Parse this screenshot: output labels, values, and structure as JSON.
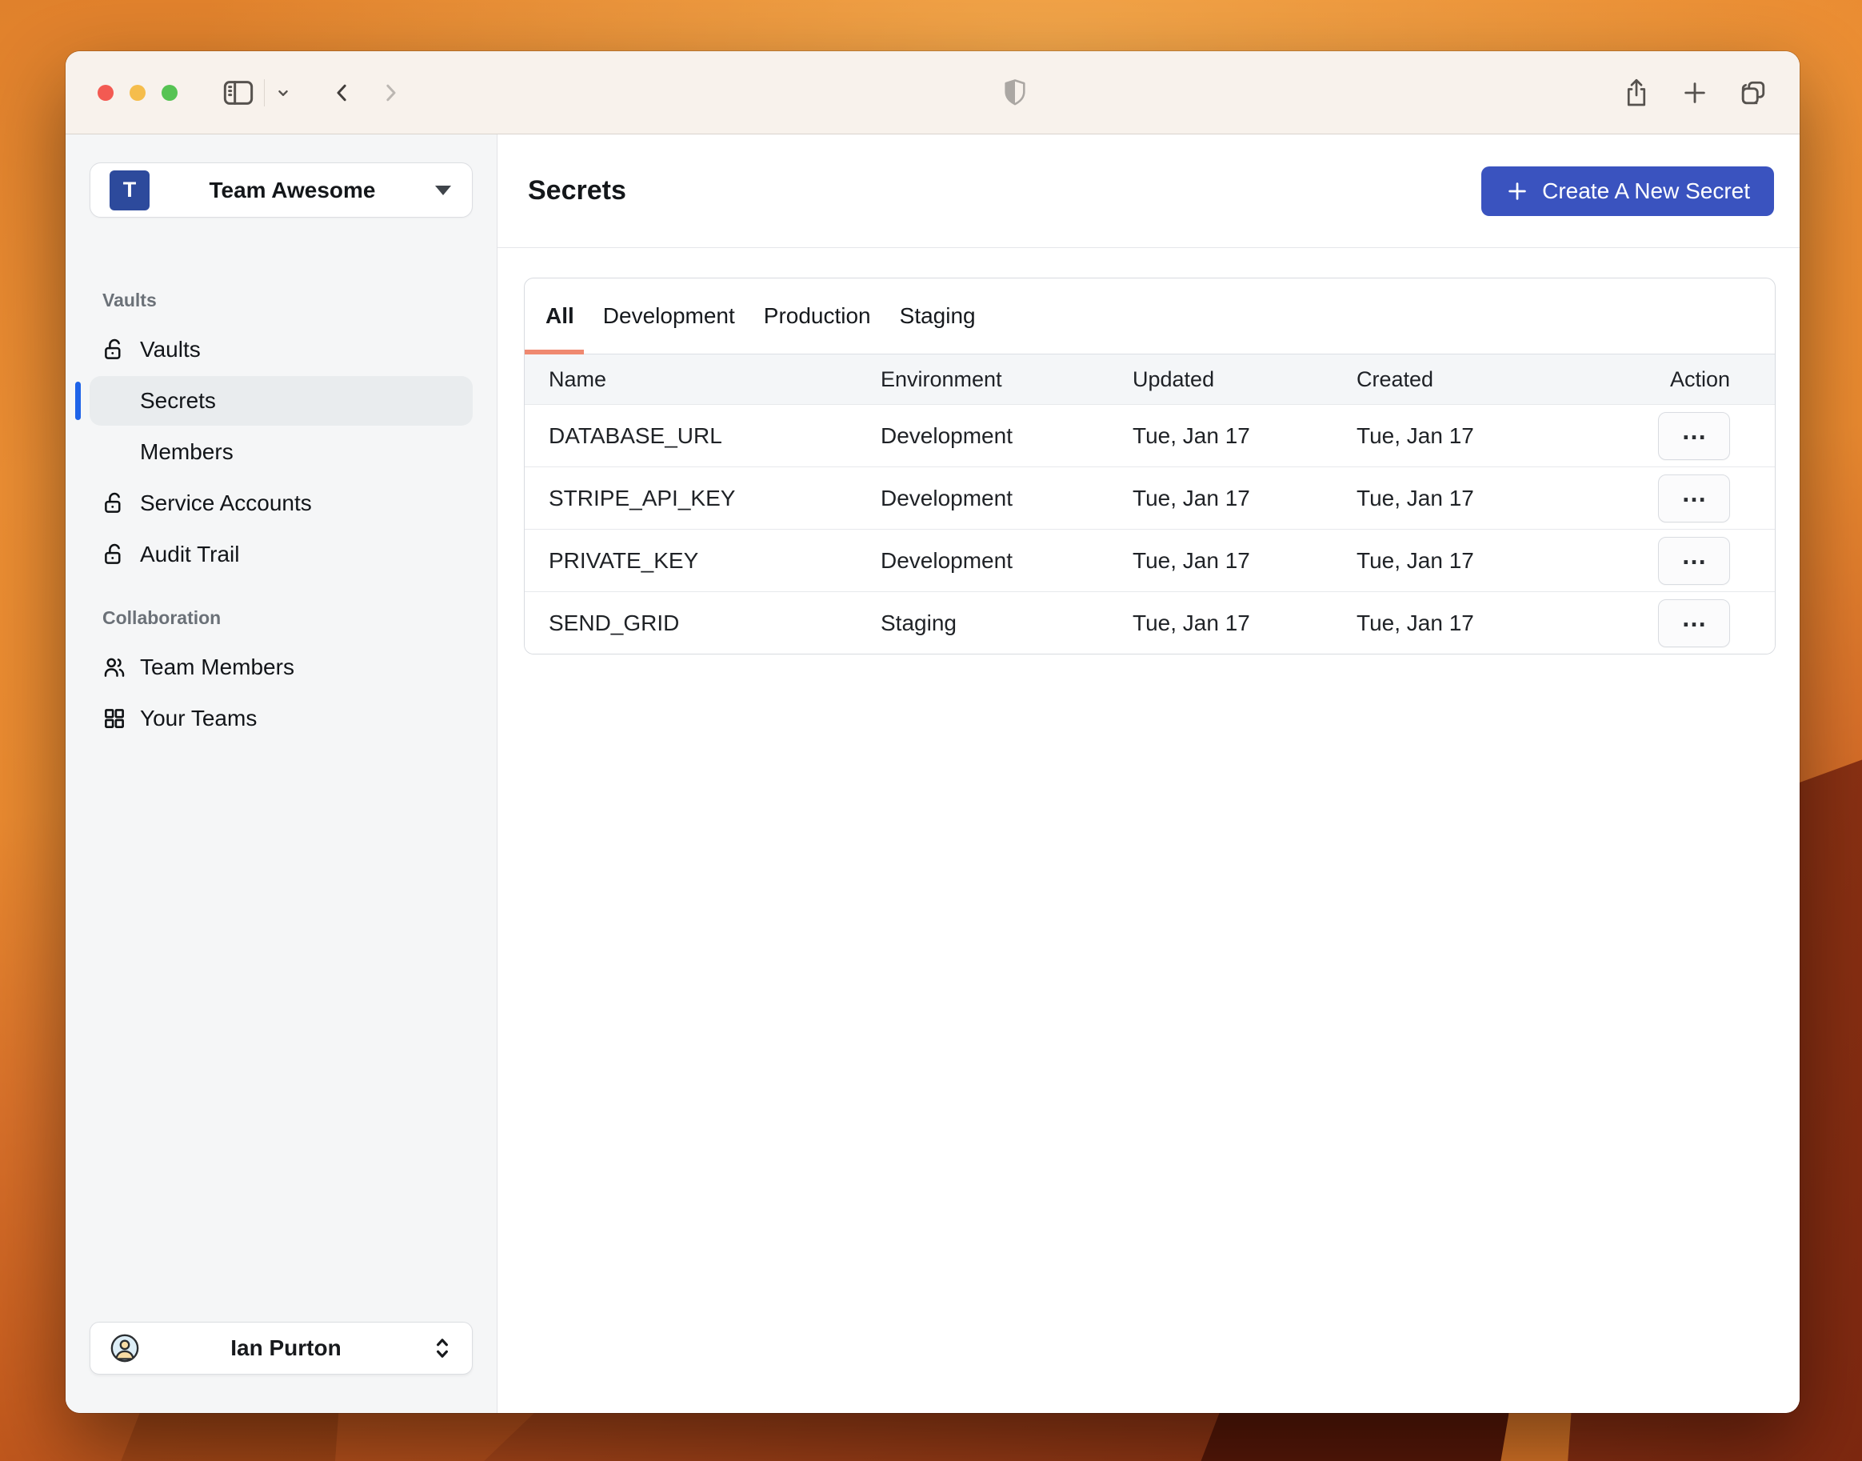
{
  "colors": {
    "primary_blue": "#3a53bf",
    "team_avatar_blue": "#2d4a9c",
    "active_tab_underline": "#ef8970",
    "selected_indicator": "#1e63e8"
  },
  "titlebar": {
    "icons": [
      "sidebar-toggle-icon",
      "chevron-down-icon",
      "back-icon",
      "forward-icon",
      "shield-icon",
      "share-icon",
      "new-tab-icon",
      "tab-overview-icon"
    ]
  },
  "sidebar": {
    "team": {
      "avatar_letter": "T",
      "name": "Team Awesome"
    },
    "sections": [
      {
        "header": "Vaults",
        "items": [
          {
            "label": "Vaults",
            "icon": "lock-open-icon"
          },
          {
            "label": "Secrets",
            "selected": true
          },
          {
            "label": "Members"
          },
          {
            "label": "Service Accounts",
            "icon": "lock-open-icon"
          },
          {
            "label": "Audit Trail",
            "icon": "lock-open-icon"
          }
        ]
      },
      {
        "header": "Collaboration",
        "items": [
          {
            "label": "Team Members",
            "icon": "users-icon"
          },
          {
            "label": "Your Teams",
            "icon": "grid-icon"
          }
        ]
      }
    ],
    "user": {
      "name": "Ian Purton",
      "icon": "user-avatar-icon"
    }
  },
  "main": {
    "title": "Secrets",
    "create_button": {
      "label": "Create A New Secret",
      "icon": "plus-icon"
    },
    "tabs": [
      {
        "label": "All",
        "active": true
      },
      {
        "label": "Development"
      },
      {
        "label": "Production"
      },
      {
        "label": "Staging"
      }
    ],
    "table": {
      "headers": [
        "Name",
        "Environment",
        "Updated",
        "Created",
        "Action"
      ],
      "action_label": "…",
      "rows": [
        {
          "name": "DATABASE_URL",
          "environment": "Development",
          "updated": "Tue, Jan 17",
          "created": "Tue, Jan 17"
        },
        {
          "name": "STRIPE_API_KEY",
          "environment": "Development",
          "updated": "Tue, Jan 17",
          "created": "Tue, Jan 17"
        },
        {
          "name": "PRIVATE_KEY",
          "environment": "Development",
          "updated": "Tue, Jan 17",
          "created": "Tue, Jan 17"
        },
        {
          "name": "SEND_GRID",
          "environment": "Staging",
          "updated": "Tue, Jan 17",
          "created": "Tue, Jan 17"
        }
      ]
    }
  }
}
